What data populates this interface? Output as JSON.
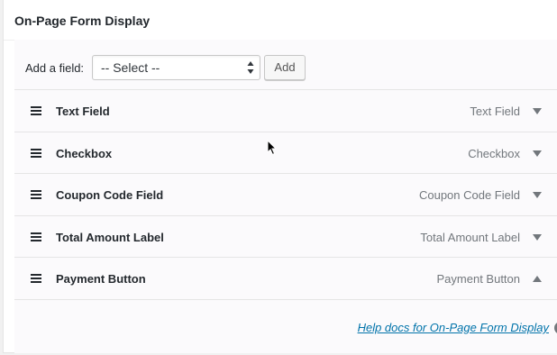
{
  "panel": {
    "title": "On-Page Form Display"
  },
  "add_field": {
    "label": "Add a field:",
    "select_value": "-- Select --",
    "add_button_label": "Add"
  },
  "fields": [
    {
      "name": "Text Field",
      "type": "Text Field",
      "toggle": "collapsed"
    },
    {
      "name": "Checkbox",
      "type": "Checkbox",
      "toggle": "collapsed"
    },
    {
      "name": "Coupon Code Field",
      "type": "Coupon Code Field",
      "toggle": "collapsed"
    },
    {
      "name": "Total Amount Label",
      "type": "Total Amount Label",
      "toggle": "collapsed"
    },
    {
      "name": "Payment Button",
      "type": "Payment Button",
      "toggle": "expanded"
    }
  ],
  "help": {
    "link_text": "Help docs for On-Page Form Display",
    "icon": "help-circle-icon"
  },
  "icons": {
    "drag": "drag-handle-icon",
    "collapsed": "triangle-down-icon",
    "expanded": "triangle-up-icon",
    "cursor": "mouse-pointer-icon"
  },
  "colors": {
    "link": "#0073aa",
    "muted_text": "#72777c",
    "text": "#23282d"
  }
}
